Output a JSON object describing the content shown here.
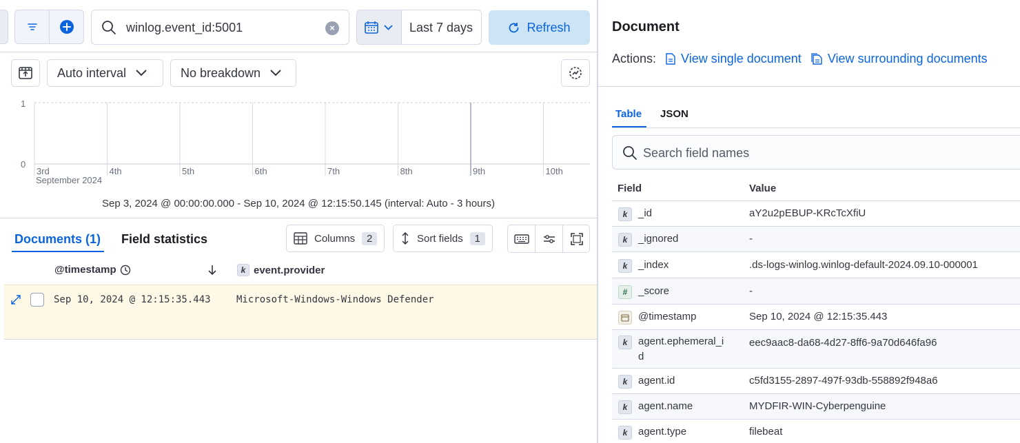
{
  "query_bar": {
    "query": "winlog.event_id:5001",
    "date_range_label": "Last 7 days",
    "refresh_label": "Refresh"
  },
  "histogram_toolbar": {
    "interval_label": "Auto interval",
    "breakdown_label": "No breakdown"
  },
  "chart_data": {
    "type": "bar",
    "y_ticks": [
      "1",
      "0"
    ],
    "x_ticks": [
      "3rd",
      "4th",
      "5th",
      "6th",
      "7th",
      "8th",
      "9th",
      "10th"
    ],
    "x_sublabel": "September 2024",
    "ylim": [
      0,
      1
    ],
    "series": [
      {
        "values": [
          0,
          0,
          0,
          0,
          0,
          0,
          0,
          1
        ]
      }
    ],
    "bar_color": "#54b399"
  },
  "time_range_summary": "Sep 3, 2024 @ 00:00:00.000 - Sep 10, 2024 @ 12:15:50.145 (interval: Auto - 3 hours)",
  "docs_tabs": {
    "documents_label": "Documents (1)",
    "field_stats_label": "Field statistics"
  },
  "docs_toolbar": {
    "columns_label": "Columns",
    "columns_count": "2",
    "sort_label": "Sort fields",
    "sort_count": "1"
  },
  "table": {
    "headers": {
      "timestamp": "@timestamp",
      "provider": "event.provider"
    },
    "provider_type_token": "k",
    "rows": [
      {
        "timestamp": "Sep 10, 2024 @ 12:15:35.443",
        "provider": "Microsoft-Windows-Windows Defender"
      }
    ]
  },
  "flyout": {
    "title": "Document",
    "actions_label": "Actions:",
    "view_single": "View single document",
    "view_surrounding": "View surrounding documents",
    "tabs": [
      "Table",
      "JSON"
    ],
    "search_placeholder": "Search field names",
    "col_field": "Field",
    "col_value": "Value",
    "fields": [
      {
        "type": "k",
        "name": "_id",
        "value": "aY2u2pEBUP-KRcTcXfiU"
      },
      {
        "type": "k",
        "name": "_ignored",
        "value": "-"
      },
      {
        "type": "k",
        "name": "_index",
        "value": ".ds-logs-winlog.winlog-default-2024.09.10-000001"
      },
      {
        "type": "#",
        "name": "_score",
        "value": "-"
      },
      {
        "type": "date",
        "name": "@timestamp",
        "value": "Sep 10, 2024 @ 12:15:35.443"
      },
      {
        "type": "k",
        "name": "agent.ephemeral_i d",
        "value": "eec9aac8-da68-4d27-8ff6-9a70d646fa96"
      },
      {
        "type": "k",
        "name": "agent.id",
        "value": "c5fd3155-2897-497f-93db-558892f948a6"
      },
      {
        "type": "k",
        "name": "agent.name",
        "value": "MYDFIR-WIN-Cyberpenguine"
      },
      {
        "type": "k",
        "name": "agent.type",
        "value": "filebeat"
      }
    ]
  },
  "colors": {
    "accent": "#0b64dd",
    "highlight_row": "#fef9e6",
    "bar": "#54b399"
  }
}
